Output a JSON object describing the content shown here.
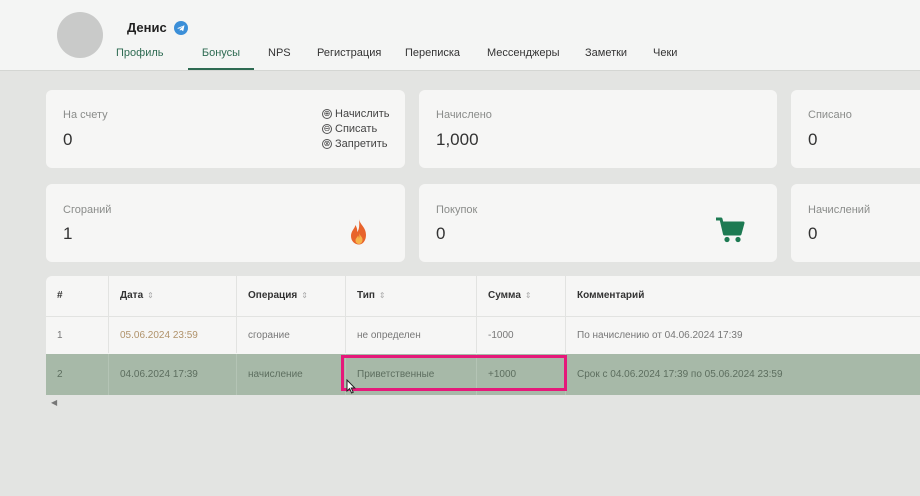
{
  "header": {
    "user_name": "Денис",
    "tabs": [
      {
        "label": "Профиль"
      },
      {
        "label": "Бонусы"
      },
      {
        "label": "NPS"
      },
      {
        "label": "Регистрация"
      },
      {
        "label": "Переписка"
      },
      {
        "label": "Мессенджеры"
      },
      {
        "label": "Заметки"
      },
      {
        "label": "Чеки"
      }
    ],
    "active_tab": "Бонусы"
  },
  "cards": {
    "on_account": {
      "label": "На счету",
      "value": "0"
    },
    "actions": [
      {
        "icon": "⊕",
        "label": "Начислить"
      },
      {
        "icon": "⊖",
        "label": "Списать"
      },
      {
        "icon": "⊗",
        "label": "Запретить"
      }
    ],
    "accrued": {
      "label": "Начислено",
      "value": "1,000"
    },
    "written_off": {
      "label": "Списано",
      "value": "0"
    },
    "burnings": {
      "label": "Сгораний",
      "value": "1",
      "icon": "fire-icon"
    },
    "purchases": {
      "label": "Покупок",
      "value": "0",
      "icon": "cart-icon"
    },
    "accruals": {
      "label": "Начислений",
      "value": "0"
    }
  },
  "table": {
    "columns": [
      "#",
      "Дата",
      "Операция",
      "Тип",
      "Сумма",
      "Комментарий"
    ],
    "sort_icon": "⇕",
    "rows": [
      [
        "1",
        "05.06.2024 23:59",
        "сгорание",
        "не определен",
        "-1000",
        "По начислению от 04.06.2024 17:39"
      ],
      [
        "2",
        "04.06.2024 17:39",
        "начисление",
        "Приветственные",
        "+1000",
        "Срок с 04.06.2024 17:39 по 05.06.2024 23:59"
      ]
    ],
    "selected_row": 2
  },
  "colors": {
    "accent": "#2e6b52",
    "highlight_border": "#e5197a",
    "selected_row_bg": "#a7b9a8",
    "fire": "#e8642c",
    "cart": "#1d7a52",
    "telegram": "#3b8fd8"
  }
}
